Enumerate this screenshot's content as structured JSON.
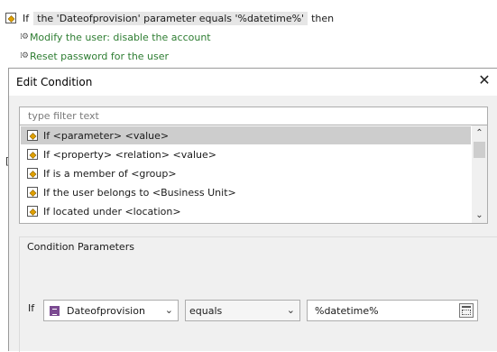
{
  "rule": {
    "if_word": "If",
    "condition_text": "the 'Dateofprovision' parameter equals '%datetime%'",
    "then_word": "then",
    "actions": [
      "Modify the user: disable the account",
      "Reset password for the user"
    ]
  },
  "background_stub": "[",
  "dialog": {
    "title": "Edit Condition",
    "close_glyph": "✕",
    "filter_placeholder": "type filter text",
    "condition_types": [
      "If <parameter> <value>",
      "If <property> <relation> <value>",
      "If is a member of <group>",
      "If the user belongs to <Business Unit>",
      "If located under <location>"
    ],
    "selected_index": 0,
    "scroll_up": "⌃",
    "scroll_down": "⌄",
    "params_title": "Condition Parameters",
    "if_label": "If",
    "parameter_value": "Dateofprovision",
    "relation_value": "equals",
    "value_text": "%datetime%",
    "dropdown_glyph": "⌄"
  },
  "colors": {
    "action_text": "#2e7d32",
    "selected_row": "#cdcdcd",
    "dialog_bg": "#f0f0f0",
    "condition_icon": "#e0a000",
    "parameter_icon": "#7b4a91"
  }
}
